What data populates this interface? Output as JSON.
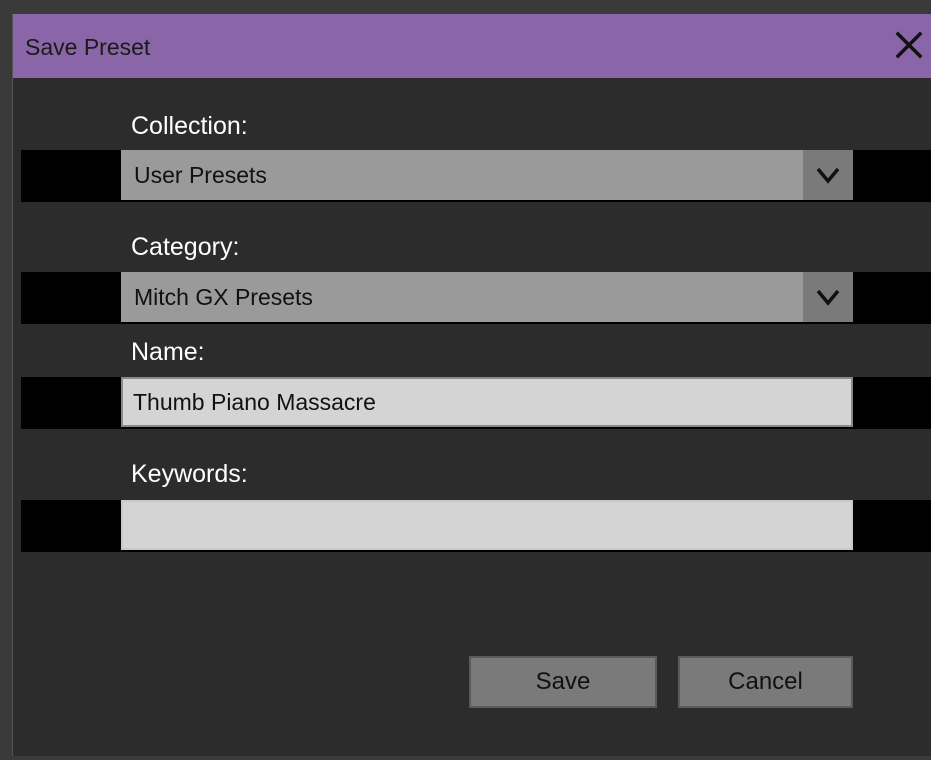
{
  "dialog": {
    "title": "Save Preset",
    "close_icon": "close-icon"
  },
  "collection": {
    "label": "Collection:",
    "selected": "User Presets",
    "arrow_icon": "chevron-down-icon"
  },
  "category": {
    "label": "Category:",
    "selected": "Mitch GX Presets",
    "arrow_icon": "chevron-down-icon"
  },
  "name": {
    "label": "Name:",
    "value": "Thumb Piano Massacre",
    "placeholder": ""
  },
  "keywords": {
    "label": "Keywords:",
    "value": "",
    "placeholder": ""
  },
  "buttons": {
    "save_label": "Save",
    "cancel_label": "Cancel"
  },
  "colors": {
    "titlebar": "#8a66a8",
    "background": "#2c2c2c",
    "select_bg": "#9a9a9a",
    "field_bg": "#d4d4d4",
    "button_bg": "#7a7a7a"
  }
}
